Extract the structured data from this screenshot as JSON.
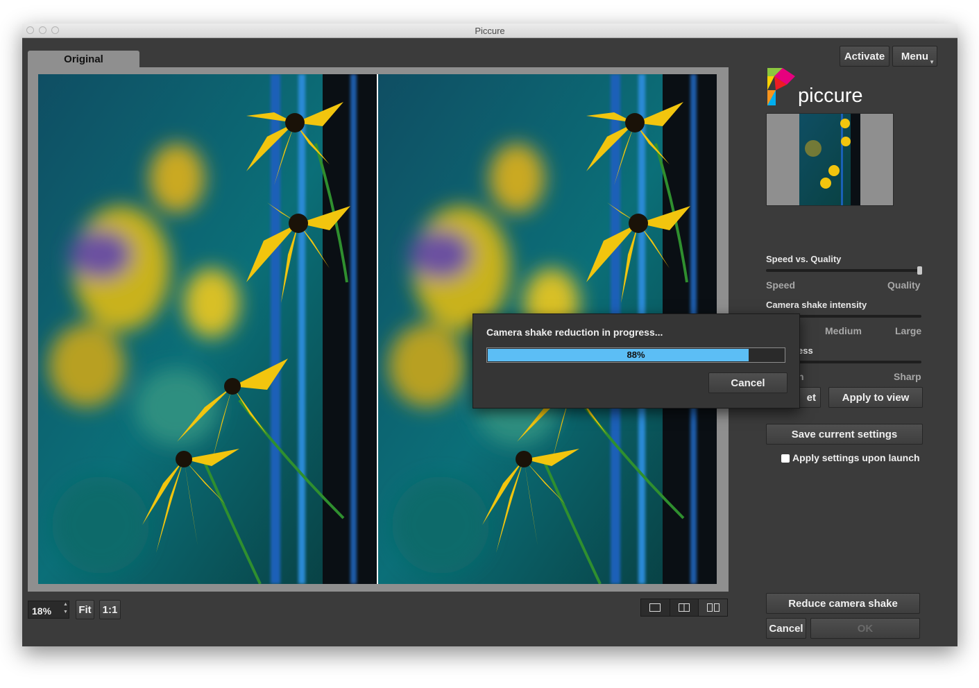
{
  "window": {
    "title": "Piccure"
  },
  "tabs": {
    "original": "Original"
  },
  "header_buttons": {
    "activate": "Activate",
    "menu": "Menu"
  },
  "brand": {
    "name": "piccure"
  },
  "controls": {
    "speed_quality": {
      "label": "Speed vs. Quality",
      "left": "Speed",
      "right": "Quality",
      "value": 1.0
    },
    "shake_intensity": {
      "label": "Camera shake intensity",
      "mid": "Medium",
      "right": "Large"
    },
    "sharpness": {
      "label_fragment": "ess",
      "left_fragment": "h",
      "right": "Sharp"
    },
    "reset_fragment": "et",
    "apply_to_view": "Apply to view",
    "save_settings": "Save current settings",
    "apply_on_launch": "Apply settings upon launch",
    "apply_on_launch_checked": false
  },
  "progress_dialog": {
    "message": "Camera shake reduction in progress...",
    "progress_percent": 88,
    "progress_label": "88%",
    "cancel": "Cancel"
  },
  "bottom_bar": {
    "zoom": "18%",
    "fit": "Fit",
    "one_to_one": "1:1"
  },
  "action_buttons": {
    "reduce": "Reduce camera shake",
    "cancel": "Cancel",
    "ok": "OK"
  },
  "colors": {
    "progress_fill": "#5cbef5",
    "window_bg": "#3b3b3b",
    "frame": "#8f8f8f"
  }
}
